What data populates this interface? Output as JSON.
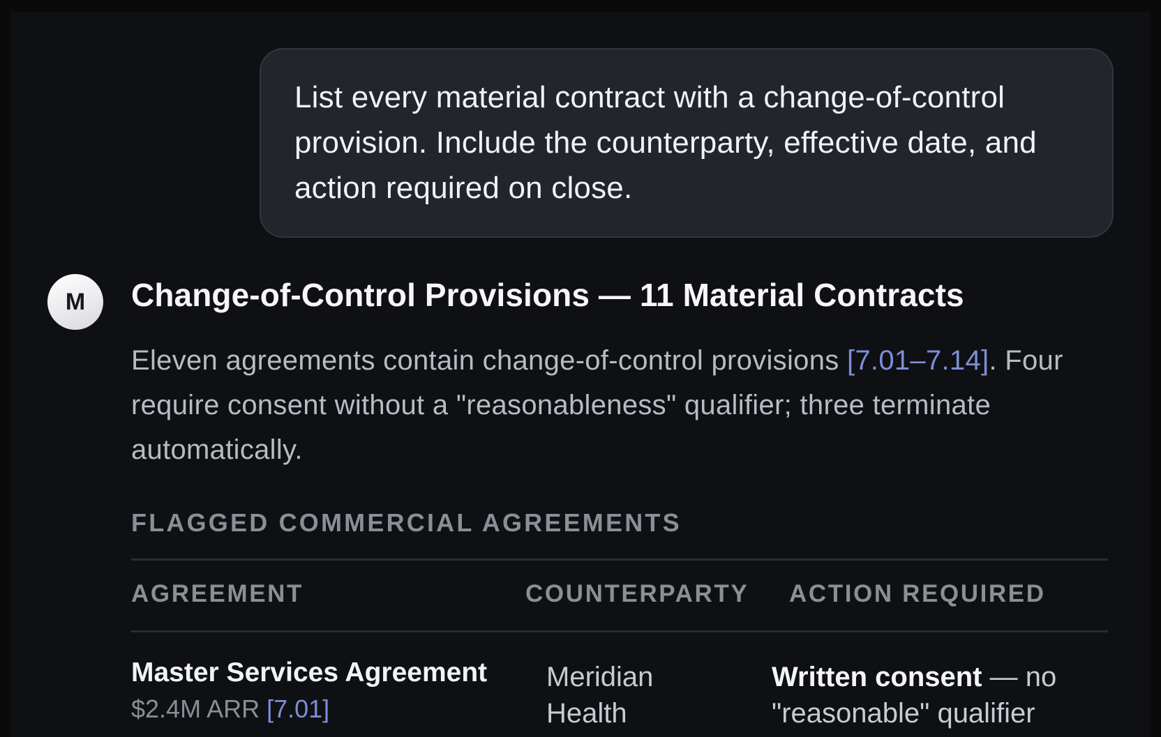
{
  "user_message": {
    "text": "List every material contract with a change-of-control provision. Include the counterparty, effective date, and action required on close."
  },
  "assistant": {
    "avatar_letter": "M",
    "title": "Change-of-Control Provisions — 11 Material Contracts",
    "summary_before_cite": "Eleven agreements contain change-of-control provisions ",
    "summary_cite": "[7.01–7.14]",
    "summary_after_cite": ". Four require consent without a \"reasonableness\" qualifier; three terminate automatically.",
    "section_label": "FLAGGED COMMERCIAL AGREEMENTS",
    "table": {
      "headers": [
        "AGREEMENT",
        "COUNTERPARTY",
        "ACTION REQUIRED"
      ],
      "rows": [
        {
          "agreement": "Master Services Agreement",
          "meta": "$2.4M ARR ",
          "meta_cite": "[7.01]",
          "counterparty": "Meridian Health",
          "action_strong": "Written consent",
          "action_rest": " — no \"reasonable\" qualifier"
        }
      ]
    }
  },
  "colors": {
    "background": "#0f1014",
    "bubble": "#23252d",
    "citation": "#7c8fd6",
    "muted": "#8c8e96"
  }
}
